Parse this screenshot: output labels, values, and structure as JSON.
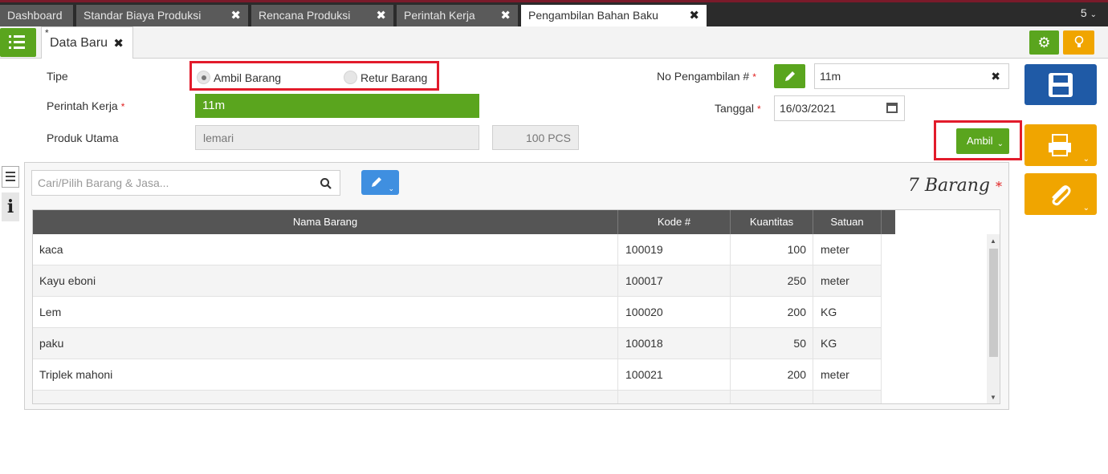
{
  "tabs": [
    {
      "label": "Dashboard",
      "closable": false
    },
    {
      "label": "Standar Biaya Produksi",
      "closable": true
    },
    {
      "label": "Rencana Produksi",
      "closable": true
    },
    {
      "label": "Perintah Kerja",
      "closable": true
    },
    {
      "label": "Pengambilan Bahan Baku",
      "closable": true,
      "active": true
    }
  ],
  "tab_count": "5",
  "subtab": {
    "star": "*",
    "label": "Data Baru"
  },
  "close_glyph": "✖",
  "form": {
    "tipe_label": "Tipe",
    "radio_ambil": "Ambil Barang",
    "radio_retur": "Retur Barang",
    "perintah_label": "Perintah Kerja",
    "perintah_value": "11m",
    "produk_label": "Produk Utama",
    "produk_value": "lemari",
    "qty_value": "100 PCS",
    "no_label": "No Pengambilan #",
    "no_value": "11m",
    "tanggal_label": "Tanggal",
    "tanggal_value": "16/03/2021",
    "ambil_label": "Ambil",
    "required_mark": "*"
  },
  "items": {
    "search_placeholder": "Cari/Pilih Barang & Jasa...",
    "count_label": "7 Barang",
    "columns": [
      "Nama Barang",
      "Kode #",
      "Kuantitas",
      "Satuan"
    ],
    "rows": [
      {
        "nama": "kaca",
        "kode": "100019",
        "qty": "100",
        "satuan": "meter"
      },
      {
        "nama": "Kayu eboni",
        "kode": "100017",
        "qty": "250",
        "satuan": "meter"
      },
      {
        "nama": "Lem",
        "kode": "100020",
        "qty": "200",
        "satuan": "KG"
      },
      {
        "nama": "paku",
        "kode": "100018",
        "qty": "50",
        "satuan": "KG"
      },
      {
        "nama": "Triplek mahoni",
        "kode": "100021",
        "qty": "200",
        "satuan": "meter"
      }
    ]
  },
  "colors": {
    "accent_green": "#5aa51e",
    "save_blue": "#1f5aa6",
    "orange": "#f0a500",
    "highlight_red": "#e21b2b"
  }
}
